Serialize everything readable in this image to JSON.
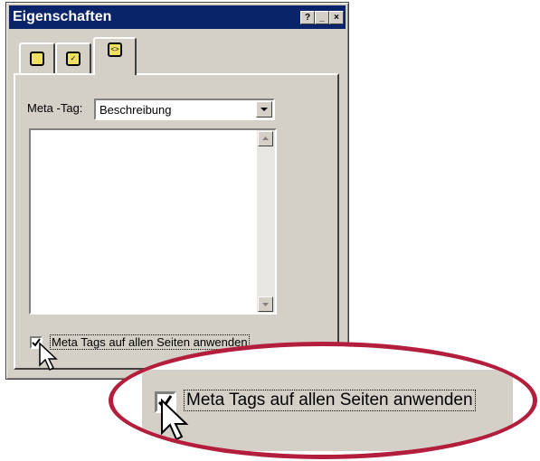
{
  "window": {
    "title": "Eigenschaften",
    "buttons": {
      "help": "?",
      "minimize": "_",
      "close": "×"
    }
  },
  "tabs": [
    {
      "icon": "page-icon",
      "active": false
    },
    {
      "icon": "checklist-icon",
      "active": false
    },
    {
      "icon": "code-tag-icon",
      "active": true
    }
  ],
  "meta": {
    "label": "Meta -Tag:",
    "selected": "Beschreibung"
  },
  "checkbox": {
    "label": "Meta Tags auf allen Seiten anwenden",
    "checked": true
  },
  "zoom": {
    "label": "Meta Tags auf allen Seiten anwenden"
  },
  "colors": {
    "titlebar": "#0a246a",
    "dialog": "#d4d0c8",
    "callout": "#b21e3c"
  }
}
